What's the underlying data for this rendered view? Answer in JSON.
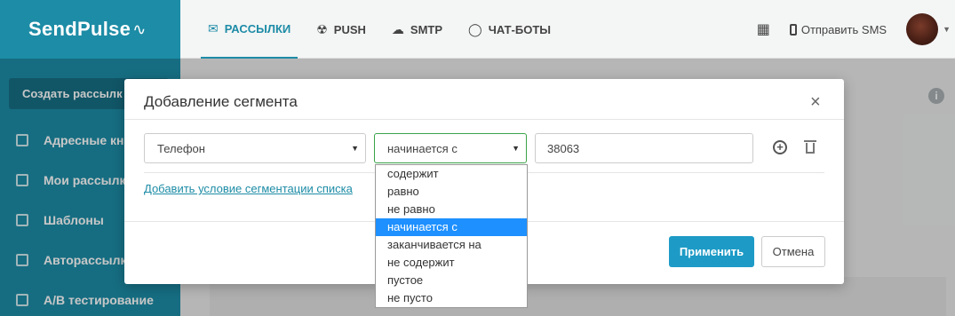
{
  "brand": {
    "logo_text": "SendPulse",
    "logo_mark": "∿",
    "accent": "#1d8ca6"
  },
  "nav": {
    "items": [
      {
        "label": "РАССЫЛКИ",
        "icon": "envelope-icon",
        "active": true
      },
      {
        "label": "PUSH",
        "icon": "bell-icon",
        "active": false
      },
      {
        "label": "SMTP",
        "icon": "cloud-icon",
        "active": false
      },
      {
        "label": "ЧАТ-БОТЫ",
        "icon": "chat-icon",
        "active": false
      }
    ],
    "sms_label": "Отправить SMS"
  },
  "sidebar": {
    "create_button": "Создать рассылк",
    "items": [
      {
        "label": "Адресные кн",
        "icon": "address-book-icon"
      },
      {
        "label": "Мои рассылк",
        "icon": "mailings-icon"
      },
      {
        "label": "Шаблоны",
        "icon": "templates-icon"
      },
      {
        "label": "Авторассылк",
        "icon": "automation-icon"
      },
      {
        "label": "A/B тестирование",
        "icon": "ab-test-icon"
      }
    ]
  },
  "modal": {
    "title": "Добавление сегмента",
    "field_select": "Телефон",
    "condition_select": "начинается с",
    "value_input": "38063",
    "add_condition_link": "Добавить условие сегментации списка",
    "apply_button": "Применить",
    "cancel_button": "Отмена"
  },
  "dropdown": {
    "options": [
      "содержит",
      "равно",
      "не равно",
      "начинается с",
      "заканчивается на",
      "не содержит",
      "пустое",
      "не пусто"
    ],
    "selected": "начинается с",
    "highlight_color": "#1e90ff"
  }
}
